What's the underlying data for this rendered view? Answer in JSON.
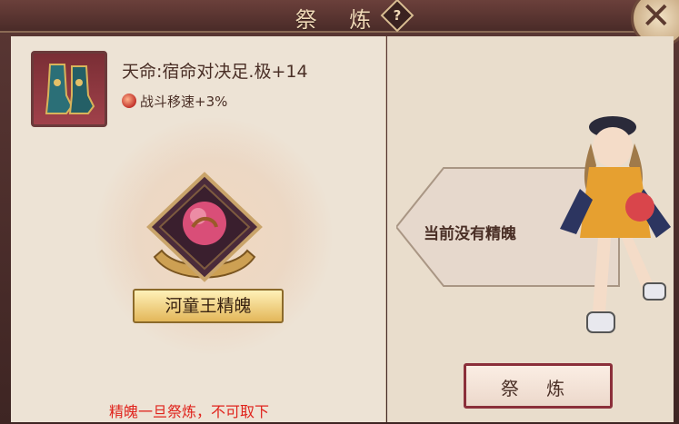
{
  "header": {
    "title": "祭 炼",
    "help_glyph": "?",
    "close_glyph": "✕"
  },
  "equipment": {
    "name": "天命:宿命对决足.极+14",
    "icon": "boots-icon",
    "buff_icon": "red-orb-icon",
    "buff": "战斗移速+3%"
  },
  "soul": {
    "label": "河童王精魄",
    "icon": "soul-orb-icon"
  },
  "warning": "精魄一旦祭炼，不可取下",
  "right": {
    "empty_message": "当前没有精魄"
  },
  "actions": {
    "refine_label": "祭 炼"
  },
  "colors": {
    "warning": "#e0231c",
    "button_border": "#8b2f3a",
    "label_gold": "#e3b75a"
  }
}
